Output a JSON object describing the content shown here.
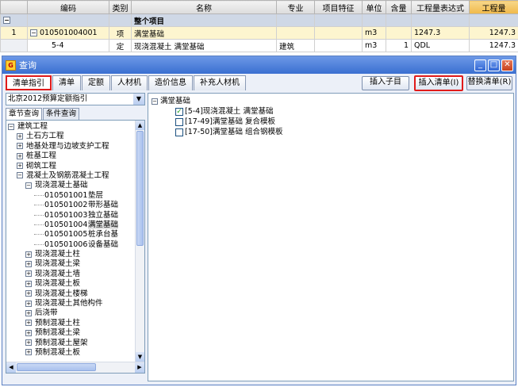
{
  "grid": {
    "headers": [
      "",
      "编码",
      "类别",
      "名称",
      "专业",
      "项目特征",
      "单位",
      "含量",
      "工程量表达式",
      "工程量"
    ],
    "section_label": "整个项目",
    "rows": [
      {
        "index": "1",
        "code": "010501004001",
        "category": "项",
        "name": "满堂基础",
        "major": "",
        "feature": "",
        "unit": "m3",
        "amount": "",
        "expr": "1247.3",
        "qty": "1247.3"
      },
      {
        "index": "",
        "code": "5-4",
        "category": "定",
        "name": "现浇混凝土 满堂基础",
        "major": "建筑",
        "feature": "",
        "unit": "m3",
        "amount": "1",
        "expr": "QDL",
        "qty": "1247.3"
      }
    ]
  },
  "dialog": {
    "title": "查询",
    "tabs": [
      "清单指引",
      "清单",
      "定额",
      "人材机",
      "造价信息",
      "补充人材机"
    ],
    "buttons": {
      "insert_child": "插入子目",
      "insert_list": "插入清单(I)",
      "replace_list": "替换清单(R)"
    },
    "dropdown_value": "北京2012预算定额指引",
    "subtabs": [
      "章节查询",
      "条件查询"
    ],
    "tree": [
      {
        "level": 0,
        "toggle": "−",
        "code": "",
        "label": "建筑工程"
      },
      {
        "level": 1,
        "toggle": "+",
        "code": "",
        "label": "土石方工程"
      },
      {
        "level": 1,
        "toggle": "+",
        "code": "",
        "label": "地基处理与边坡支护工程"
      },
      {
        "level": 1,
        "toggle": "+",
        "code": "",
        "label": "桩基工程"
      },
      {
        "level": 1,
        "toggle": "+",
        "code": "",
        "label": "砌筑工程"
      },
      {
        "level": 1,
        "toggle": "−",
        "code": "",
        "label": "混凝土及钢筋混凝土工程"
      },
      {
        "level": 2,
        "toggle": "−",
        "code": "",
        "label": "现浇混凝土基础"
      },
      {
        "level": 3,
        "toggle": "",
        "code": "010501001",
        "label": "垫层"
      },
      {
        "level": 3,
        "toggle": "",
        "code": "010501002",
        "label": "带形基础"
      },
      {
        "level": 3,
        "toggle": "",
        "code": "010501003",
        "label": "独立基础"
      },
      {
        "level": 3,
        "toggle": "",
        "code": "010501004",
        "label": "满堂基础",
        "selected": true
      },
      {
        "level": 3,
        "toggle": "",
        "code": "010501005",
        "label": "桩承台基"
      },
      {
        "level": 3,
        "toggle": "",
        "code": "010501006",
        "label": "设备基础"
      },
      {
        "level": 2,
        "toggle": "+",
        "code": "",
        "label": "现浇混凝土柱"
      },
      {
        "level": 2,
        "toggle": "+",
        "code": "",
        "label": "现浇混凝土梁"
      },
      {
        "level": 2,
        "toggle": "+",
        "code": "",
        "label": "现浇混凝土墙"
      },
      {
        "level": 2,
        "toggle": "+",
        "code": "",
        "label": "现浇混凝土板"
      },
      {
        "level": 2,
        "toggle": "+",
        "code": "",
        "label": "现浇混凝土楼梯"
      },
      {
        "level": 2,
        "toggle": "+",
        "code": "",
        "label": "现浇混凝土其他构件"
      },
      {
        "level": 2,
        "toggle": "+",
        "code": "",
        "label": "后浇带"
      },
      {
        "level": 2,
        "toggle": "+",
        "code": "",
        "label": "预制混凝土柱"
      },
      {
        "level": 2,
        "toggle": "+",
        "code": "",
        "label": "预制混凝土梁"
      },
      {
        "level": 2,
        "toggle": "+",
        "code": "",
        "label": "预制混凝土屋架"
      },
      {
        "level": 2,
        "toggle": "+",
        "code": "",
        "label": "预制混凝土板"
      }
    ],
    "right": {
      "root": "满堂基础",
      "items": [
        {
          "checked": true,
          "label": "[5-4]现浇混凝土 满堂基础"
        },
        {
          "checked": false,
          "label": "[17-49]满堂基础 复合模板"
        },
        {
          "checked": false,
          "label": "[17-50]满堂基础 组合钢模板"
        }
      ]
    }
  },
  "colors": {
    "highlight_red": "#e01b1b",
    "title_blue": "#3a6fd1",
    "section_bg": "#cfd8e6"
  }
}
